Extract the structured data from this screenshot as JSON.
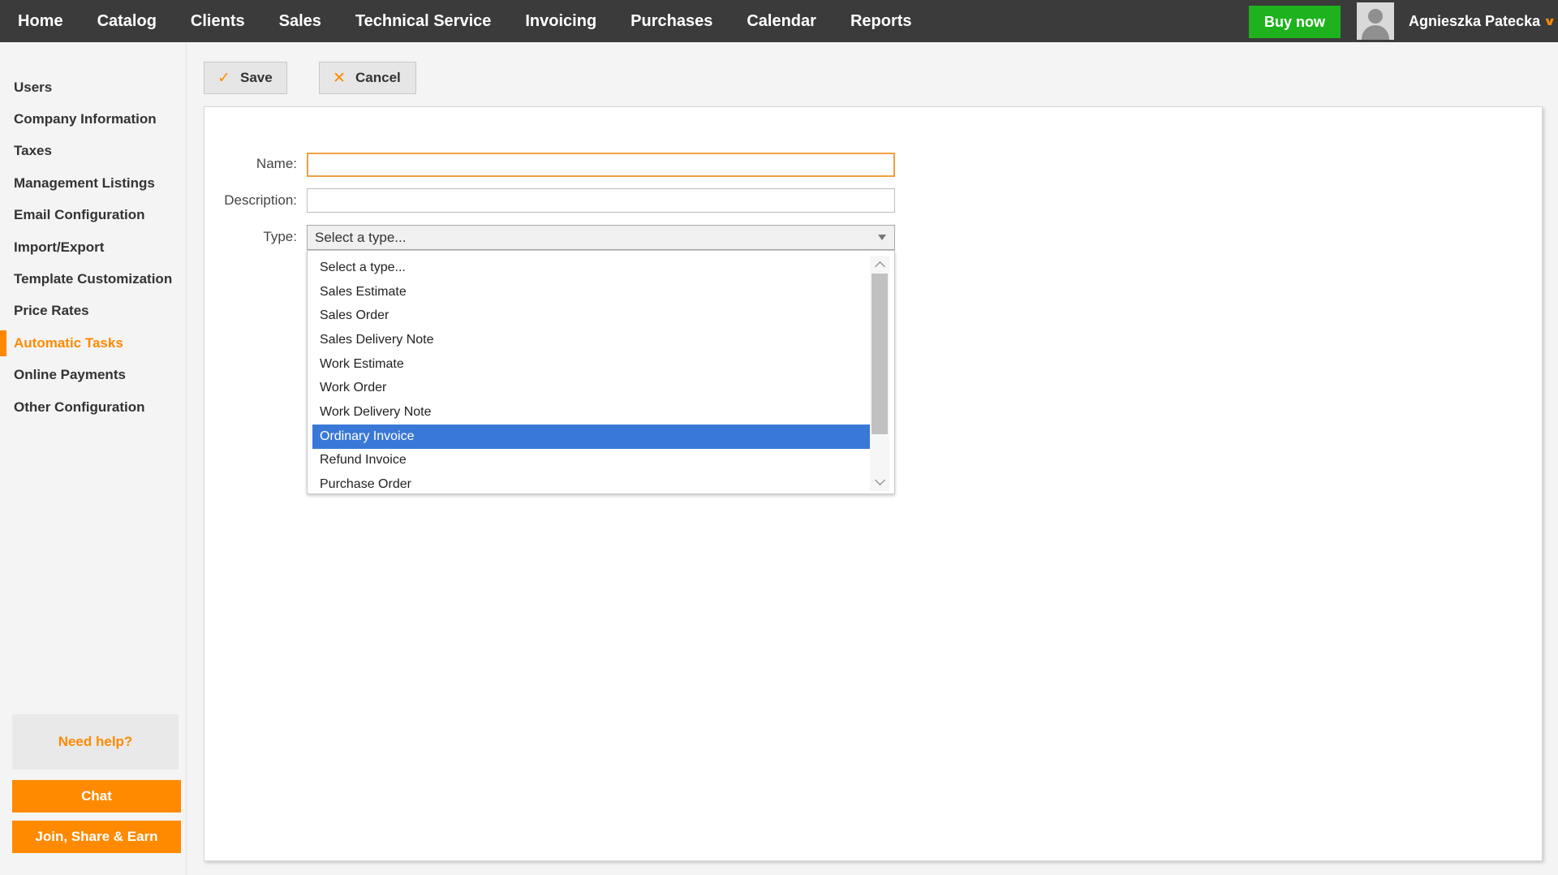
{
  "nav": {
    "items": [
      "Home",
      "Catalog",
      "Clients",
      "Sales",
      "Technical Service",
      "Invoicing",
      "Purchases",
      "Calendar",
      "Reports"
    ],
    "buy_now": "Buy now",
    "user_name": "Agnieszka Patecka"
  },
  "sidebar": {
    "items": [
      "Users",
      "Company Information",
      "Taxes",
      "Management Listings",
      "Email Configuration",
      "Import/Export",
      "Template Customization",
      "Price Rates",
      "Automatic Tasks",
      "Online Payments",
      "Other Configuration"
    ],
    "active": "Automatic Tasks",
    "help": "Need help?",
    "chat": "Chat",
    "join": "Join, Share & Earn"
  },
  "toolbar": {
    "save": "Save",
    "cancel": "Cancel"
  },
  "form": {
    "name_label": "Name:",
    "name_value": "",
    "description_label": "Description:",
    "description_value": "",
    "type_label": "Type:",
    "type_value": "Select a type...",
    "type_options": [
      "Select a type...",
      "Sales Estimate",
      "Sales Order",
      "Sales Delivery Note",
      "Work Estimate",
      "Work Order",
      "Work Delivery Note",
      "Ordinary Invoice",
      "Refund Invoice",
      "Purchase Order"
    ],
    "highlighted_option": "Ordinary Invoice"
  },
  "colors": {
    "topbar": "#3b3b3b",
    "accent": "#ff8a00",
    "buy_now": "#1eb31e",
    "option_highlight": "#3a78d8"
  }
}
